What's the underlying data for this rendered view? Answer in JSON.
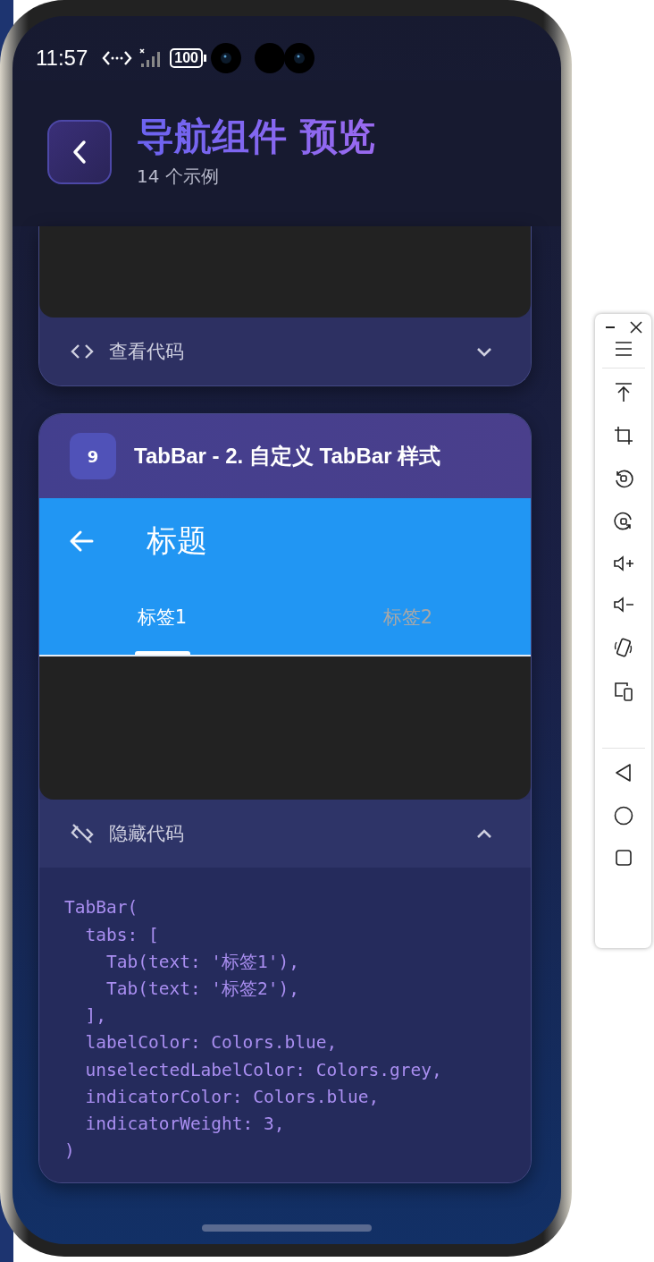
{
  "status_bar": {
    "time": "11:57",
    "battery": "100"
  },
  "header": {
    "title": "导航组件 预览",
    "subtitle": "14 个示例"
  },
  "examples": [
    {
      "expanded": false,
      "toggle_label": "查看代码"
    },
    {
      "number": "9",
      "title": "TabBar - 2. 自定义 TabBar 样式",
      "preview": {
        "app_bar_title": "标题",
        "tabs": [
          {
            "label": "标签1",
            "selected": true
          },
          {
            "label": "标签2",
            "selected": false
          }
        ]
      },
      "expanded": true,
      "toggle_label": "隐藏代码",
      "code": "TabBar(\n  tabs: [\n    Tab(text: '标签1'),\n    Tab(text: '标签2'),\n  ],\n  labelColor: Colors.blue,\n  unselectedLabelColor: Colors.grey,\n  indicatorColor: Colors.blue,\n  indicatorWeight: 3,\n)"
    }
  ]
}
